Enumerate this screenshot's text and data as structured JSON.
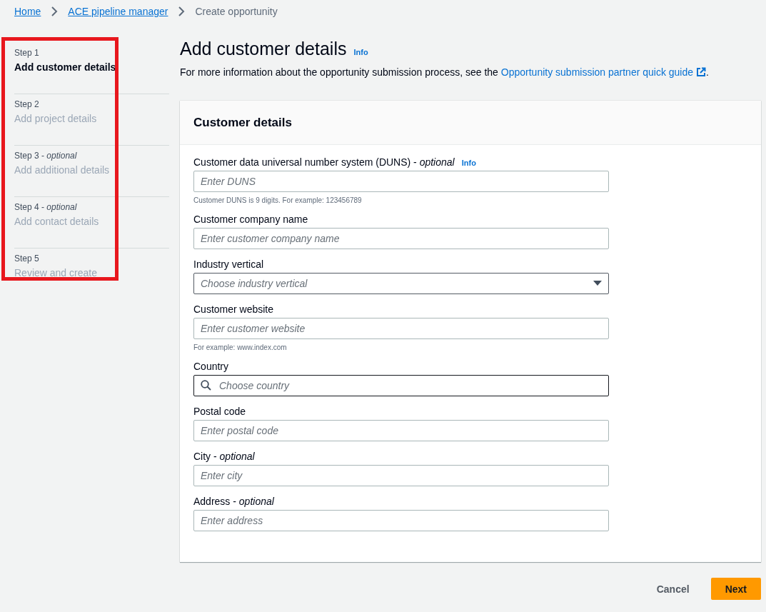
{
  "breadcrumbs": [
    {
      "label": "Home",
      "link": true
    },
    {
      "label": "ACE pipeline manager",
      "link": true
    },
    {
      "label": "Create opportunity",
      "link": false
    }
  ],
  "steps": [
    {
      "step": "Step 1",
      "title": "Add customer details",
      "selected": true
    },
    {
      "step": "Step 2",
      "title": "Add project details",
      "selected": false
    },
    {
      "step": "Step 3 - *optional*",
      "title": "Add additional details",
      "selected": false
    },
    {
      "step": "Step 4 - *optional*",
      "title": "Add contact details",
      "selected": false
    },
    {
      "step": "Step 5",
      "title": "Review and create",
      "selected": false
    }
  ],
  "highlight": true,
  "page": {
    "title": "Add customer details",
    "info": "Info",
    "description": "For more information about the opportunity submission process, see the",
    "guide_link": "Opportunity submission partner quick guide",
    "description_end": "."
  },
  "card": {
    "title": "Customer details",
    "fields": [
      {
        "kind": "text",
        "label": "Customer data universal number system (DUNS) - *optional*",
        "info": "Info",
        "placeholder": "Enter DUNS",
        "hint": "Customer DUNS is 9 digits. For example: 123456789"
      },
      {
        "kind": "text",
        "label": "Customer company name",
        "placeholder": "Enter customer company name"
      },
      {
        "kind": "select",
        "label": "Industry vertical",
        "placeholder": "Choose industry vertical"
      },
      {
        "kind": "text",
        "label": "Customer website",
        "placeholder": "Enter customer website",
        "hint": "For example: www.index.com"
      },
      {
        "kind": "search",
        "label": "Country",
        "placeholder": "Choose country"
      },
      {
        "kind": "text",
        "label": "Postal code",
        "placeholder": "Enter postal code"
      },
      {
        "kind": "text",
        "label": "City - *optional*",
        "placeholder": "Enter city"
      },
      {
        "kind": "text",
        "label": "Address - *optional*",
        "placeholder": "Enter address"
      }
    ]
  },
  "actions": {
    "cancel": "Cancel",
    "next": "Next"
  }
}
